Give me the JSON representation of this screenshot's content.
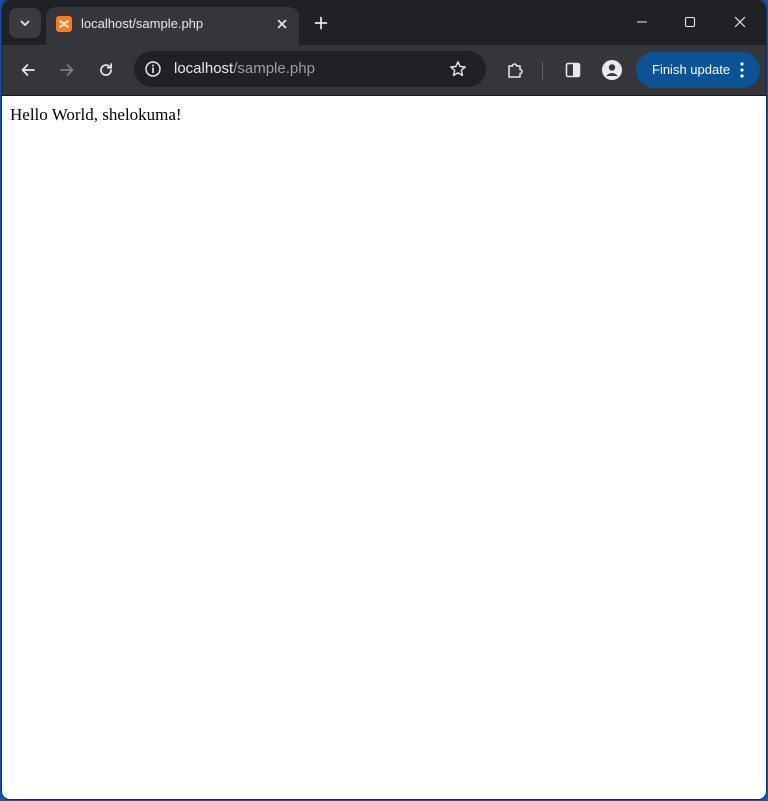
{
  "tab": {
    "title": "localhost/sample.php"
  },
  "omnibox": {
    "url_host": "localhost",
    "url_path": "/sample.php"
  },
  "toolbar": {
    "finish_update_label": "Finish update"
  },
  "page": {
    "body_text": "Hello World, shelokuma!"
  },
  "colors": {
    "titlebar": "#202124",
    "toolbar": "#35363a",
    "update_button": "#0b5394",
    "favicon": "#fb7a24"
  }
}
